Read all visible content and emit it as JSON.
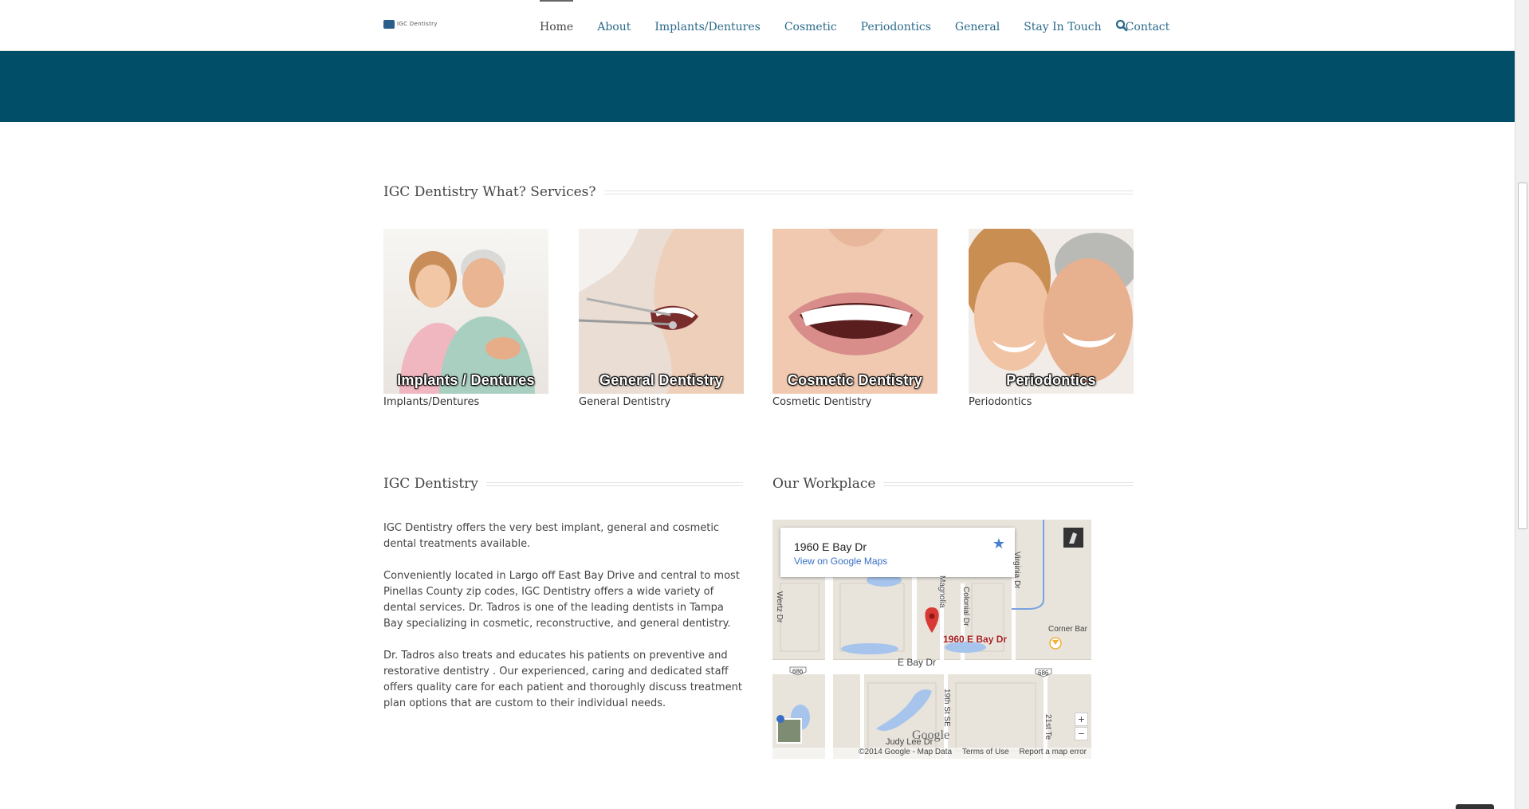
{
  "header": {
    "logo_text": "IGC Dentistry",
    "nav": [
      {
        "label": "Home",
        "active": true
      },
      {
        "label": "About"
      },
      {
        "label": "Implants/Dentures"
      },
      {
        "label": "Cosmetic"
      },
      {
        "label": "Periodontics"
      },
      {
        "label": "General"
      },
      {
        "label": "Stay In Touch"
      },
      {
        "label": "Contact"
      }
    ],
    "search_icon": "search-icon"
  },
  "colors": {
    "banner": "#004e68",
    "nav_link": "#2a6a8a",
    "map_link": "#3a6fc5"
  },
  "services": {
    "title": "IGC Dentistry What? Services?",
    "items": [
      {
        "overlay": "Implants / Dentures",
        "caption": "Implants/Dentures"
      },
      {
        "overlay": "General Dentistry",
        "caption": "General Dentistry"
      },
      {
        "overlay": "Cosmetic Dentistry",
        "caption": "Cosmetic Dentistry"
      },
      {
        "overlay": "Periodontics",
        "caption": "Periodontics"
      }
    ]
  },
  "about": {
    "title": "IGC Dentistry",
    "paragraphs": [
      "IGC Dentistry offers the very best implant, general and cosmetic dental treatments available.",
      "Conveniently located in Largo off East Bay Drive and central to most Pinellas County zip codes, IGC Dentistry offers a wide variety of dental services. Dr. Tadros is one of the leading dentists in Tampa Bay specializing in cosmetic, reconstructive, and general dentistry.",
      "Dr. Tadros also treats and educates his patients on preventive and restorative dentistry . Our experienced, caring and dedicated staff offers quality care for each patient and thoroughly discuss treatment plan options that are custom to their individual needs."
    ]
  },
  "workplace": {
    "title": "Our Workplace",
    "map": {
      "info_address": "1960 E Bay Dr",
      "info_link": "View on Google Maps",
      "marker_label": "1960 E Bay Dr",
      "road_label": "E Bay Dr",
      "route_badge": "686",
      "street_labels": [
        "Wertz Dr",
        "Magnolia",
        "Colonial Dr",
        "Virginia Dr",
        "19th St SE",
        "21st Te",
        "Judy Lee Dr"
      ],
      "poi_label": "Corner Bar",
      "brand": "Google",
      "zoom_in": "+",
      "zoom_out": "−",
      "footer": [
        "©2014 Google - Map Data",
        "Terms of Use",
        "Report a map error"
      ]
    }
  }
}
